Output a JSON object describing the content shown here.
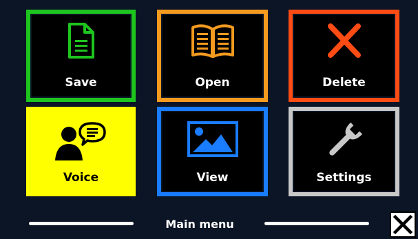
{
  "menu": {
    "tiles": [
      {
        "label": "Save",
        "icon": "document-icon",
        "color": "#1ec51e"
      },
      {
        "label": "Open",
        "icon": "book-icon",
        "color": "#f39a1f"
      },
      {
        "label": "Delete",
        "icon": "x-icon",
        "color": "#ff4c14"
      },
      {
        "label": "Voice",
        "icon": "speaking-person-icon",
        "color": "#ffff00"
      },
      {
        "label": "View",
        "icon": "image-icon",
        "color": "#1a7cff"
      },
      {
        "label": "Settings",
        "icon": "wrench-icon",
        "color": "#c8c8c8"
      }
    ]
  },
  "footer": {
    "title": "Main menu",
    "close_icon": "close-icon"
  }
}
